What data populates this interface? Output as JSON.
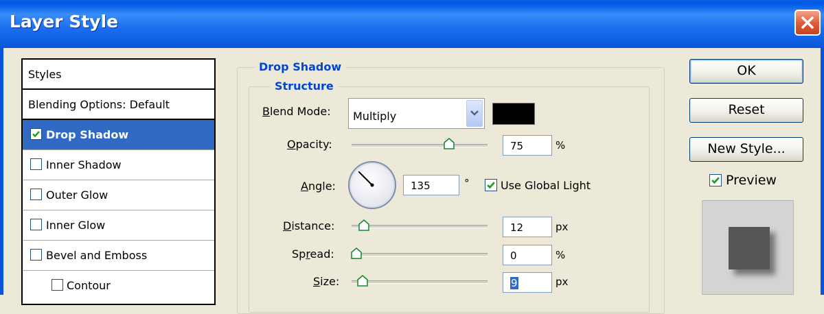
{
  "window": {
    "title": "Layer Style"
  },
  "styles_list": {
    "header": "Styles",
    "blending": "Blending Options: Default",
    "items": [
      {
        "label": "Drop Shadow",
        "checked": true,
        "selected": true
      },
      {
        "label": "Inner Shadow",
        "checked": false
      },
      {
        "label": "Outer Glow",
        "checked": false
      },
      {
        "label": "Inner Glow",
        "checked": false
      },
      {
        "label": "Bevel and Emboss",
        "checked": false
      },
      {
        "label": "Contour",
        "checked": false
      }
    ]
  },
  "drop_shadow": {
    "group_title": "Drop Shadow",
    "structure_title": "Structure",
    "blend_mode": {
      "label": "Blend Mode:",
      "value": "Multiply",
      "color": "#000000"
    },
    "opacity": {
      "label": "Opacity:",
      "value": "75",
      "unit": "%",
      "fraction": 0.75
    },
    "angle": {
      "label": "Angle:",
      "value": "135",
      "unit": "°",
      "degrees": 135
    },
    "use_global_light": {
      "label": "Use Global Light",
      "checked": true
    },
    "distance": {
      "label": "Distance:",
      "value": "12",
      "unit": "px",
      "fraction": 0.06
    },
    "spread": {
      "label": "Spread:",
      "value": "0",
      "unit": "%",
      "fraction": 0.0
    },
    "size": {
      "label": "Size:",
      "value": "9",
      "unit": "px",
      "fraction": 0.05
    }
  },
  "buttons": {
    "ok": "OK",
    "reset": "Reset",
    "new_style": "New Style..."
  },
  "preview": {
    "label": "Preview",
    "checked": true
  },
  "colors": {
    "title_bar": "#0a5ee6",
    "selection": "#316ac5",
    "group_title": "#0046d5",
    "dialog_bg": "#ece9d8"
  },
  "icons": {
    "close": "close-icon",
    "dropdown": "chevron-down-icon",
    "check": "check-icon"
  }
}
